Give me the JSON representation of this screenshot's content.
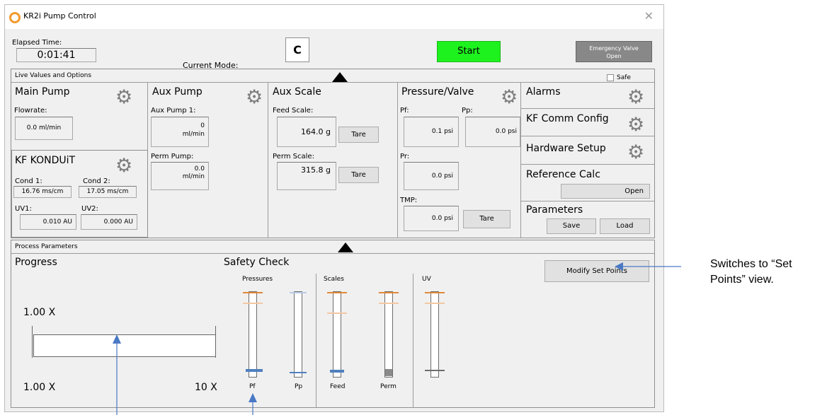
{
  "window": {
    "title": "KR2i Pump Control",
    "close_glyph": "✕"
  },
  "top": {
    "elapsed_label": "Elapsed Time:",
    "elapsed_value": "0:01:41",
    "current_mode_label": "Current Mode:",
    "current_mode_value": "C",
    "start_label": "Start",
    "emergency_line1": "Emergency Valve",
    "emergency_line2": "Open"
  },
  "live": {
    "title": "Live Values and Options",
    "safe_label": "Safe",
    "main_pump": {
      "title": "Main Pump",
      "flowrate_label": "Flowrate:",
      "flowrate_value": "0.0  ml/min"
    },
    "kf_konduit": {
      "title": "KF KONDUiT",
      "cond1_label": "Cond 1:",
      "cond1_value": "16.76 ms/cm",
      "cond2_label": "Cond 2:",
      "cond2_value": "17.05 ms/cm",
      "uv1_label": "UV1:",
      "uv1_value": "0.010 AU",
      "uv2_label": "UV2:",
      "uv2_value": "0.000 AU"
    },
    "aux_pump": {
      "title": "Aux Pump",
      "aux1_label": "Aux Pump 1:",
      "aux1_value": "0",
      "aux1_unit": "ml/min",
      "perm_label": "Perm Pump:",
      "perm_value": "0.0",
      "perm_unit": "ml/min"
    },
    "aux_scale": {
      "title": "Aux Scale",
      "feed_label": "Feed Scale:",
      "feed_value": "164.0 g",
      "perm_label": "Perm Scale:",
      "perm_value": "315.8 g",
      "tare_label": "Tare"
    },
    "pressure_valve": {
      "title": "Pressure/Valve",
      "pf_label": "Pf:",
      "pf_value": "0.1 psi",
      "pp_label": "Pp:",
      "pp_value": "0.0 psi",
      "pr_label": "Pr:",
      "pr_value": "0.0 psi",
      "tmp_label": "TMP:",
      "tmp_value": "0.0 psi",
      "tare_label": "Tare"
    },
    "right": {
      "alarms": "Alarms",
      "kf_comm": "KF Comm Config",
      "hardware": "Hardware Setup",
      "reference_calc": "Reference Calc",
      "open_label": "Open",
      "parameters": "Parameters",
      "save_label": "Save",
      "load_label": "Load"
    }
  },
  "process": {
    "title": "Process Parameters",
    "progress": {
      "title": "Progress",
      "top_value": "1.00 X",
      "start_label": "1.00 X",
      "end_label": "10 X",
      "fill_fraction": 0
    },
    "safety": {
      "title": "Safety Check",
      "pressures_label": "Pressures",
      "scales_label": "Scales",
      "uv_label": "UV",
      "gauges": [
        "Pf",
        "Pp",
        "Feed",
        "Perm"
      ]
    },
    "modify_label": "Modify Set Points"
  },
  "annotation": {
    "line1": "Switches to “Set",
    "line2": "Points” view."
  },
  "colors": {
    "start_green": "#1ef21e",
    "emergency_gray": "#888888",
    "gauge_orange": "#e0893a",
    "gauge_blue": "#4f7fbf",
    "arrow_blue": "#4a79c5"
  }
}
